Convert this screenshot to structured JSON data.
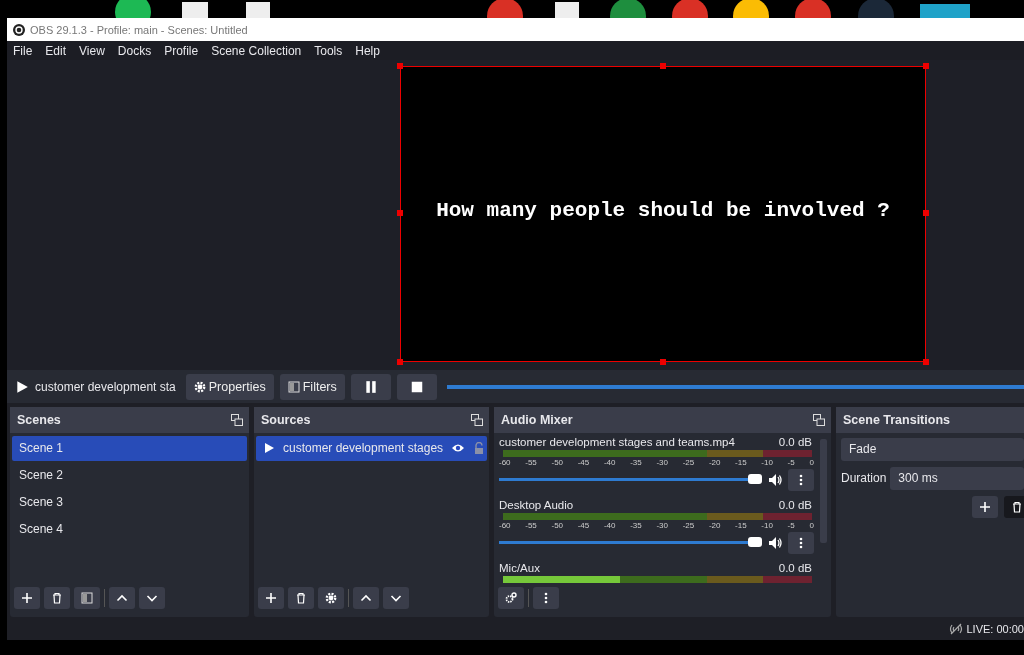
{
  "window": {
    "title": "OBS 29.1.3 - Profile: main - Scenes: Untitled"
  },
  "menu": [
    "File",
    "Edit",
    "View",
    "Docks",
    "Profile",
    "Scene Collection",
    "Tools",
    "Help"
  ],
  "preview": {
    "text": "How many people should be involved ?"
  },
  "controls": {
    "source_name": "customer development sta",
    "properties": "Properties",
    "filters": "Filters",
    "seek": {
      "level": 1
    }
  },
  "scenes": {
    "title": "Scenes",
    "items": [
      {
        "label": "Scene 1",
        "selected": true
      },
      {
        "label": "Scene 2",
        "selected": false
      },
      {
        "label": "Scene 3",
        "selected": false
      },
      {
        "label": "Scene 4",
        "selected": false
      }
    ]
  },
  "sources": {
    "title": "Sources",
    "items": [
      {
        "label": "customer development stages",
        "selected": true
      }
    ]
  },
  "audio_mixer": {
    "title": "Audio Mixer",
    "channels": [
      {
        "name": "customer development stages and teams.mp4",
        "reading": "0.0 dB",
        "meter": {
          "level": 0
        },
        "ticks": [
          "-60",
          "-55",
          "-50",
          "-45",
          "-40",
          "-35",
          "-30",
          "-25",
          "-20",
          "-15",
          "-10",
          "-5",
          "0"
        ],
        "volume": {
          "level": 1
        }
      },
      {
        "name": "Desktop Audio",
        "reading": "0.0 dB",
        "meter": {
          "level": 0
        },
        "ticks": [
          "-60",
          "-55",
          "-50",
          "-45",
          "-40",
          "-35",
          "-30",
          "-25",
          "-20",
          "-15",
          "-10",
          "-5",
          "0"
        ],
        "volume": {
          "level": 1
        }
      },
      {
        "name": "Mic/Aux",
        "reading": "0.0 dB",
        "meter": {
          "level": 0.38
        }
      }
    ]
  },
  "scene_transitions": {
    "title": "Scene Transitions",
    "transition": "Fade",
    "duration_label": "Duration",
    "duration": "300 ms"
  },
  "status_bar": {
    "live": "LIVE: 00:00"
  }
}
